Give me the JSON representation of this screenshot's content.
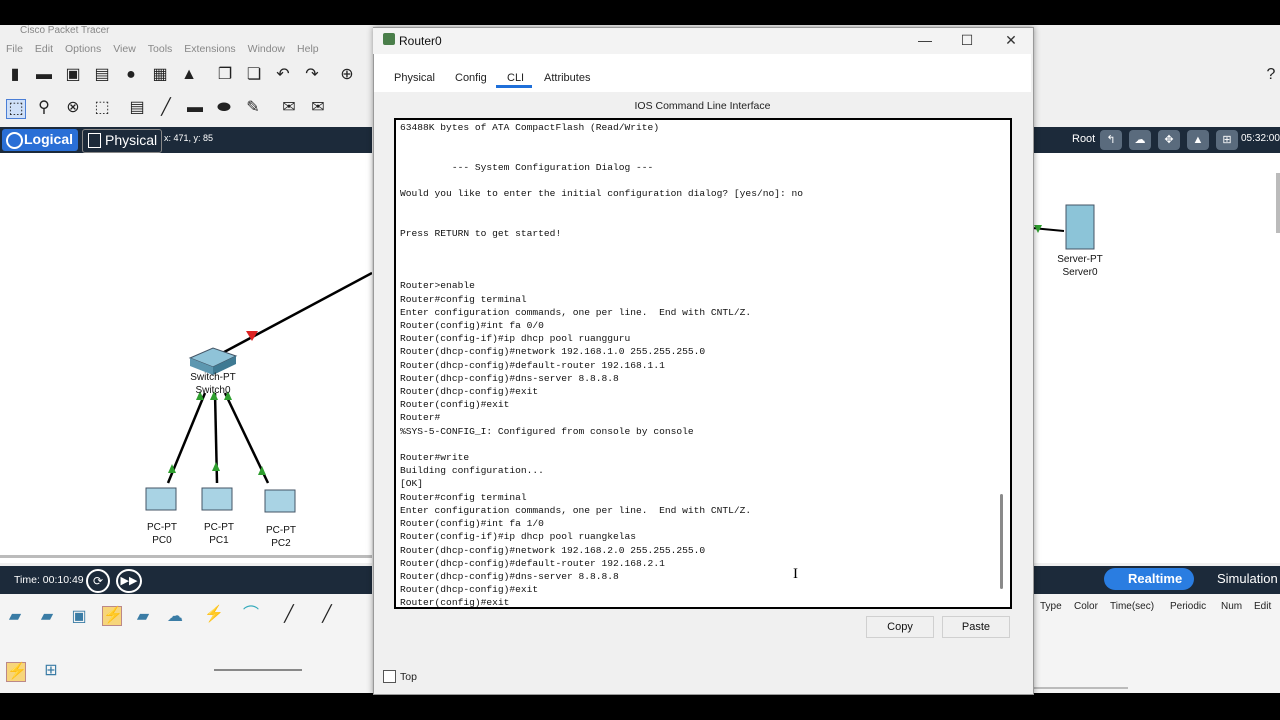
{
  "app": {
    "title": "Cisco Packet Tracer",
    "menu": [
      "File",
      "Edit",
      "Options",
      "View",
      "Tools",
      "Extensions",
      "Window",
      "Help"
    ],
    "view_tabs": {
      "logical": "Logical",
      "physical": "Physical"
    },
    "coords": "x: 471, y: 85",
    "root_label": "Root",
    "clock": "05:32:00",
    "time_label": "Time: 00:10:49",
    "realtime_label": "Realtime",
    "simulation_label": "Simulation",
    "event_columns": [
      "Type",
      "Color",
      "Time(sec)",
      "Periodic",
      "Num",
      "Edit"
    ]
  },
  "devices": {
    "switch": {
      "line1": "Switch-PT",
      "line2": "Switch0"
    },
    "pc0": {
      "line1": "PC-PT",
      "line2": "PC0"
    },
    "pc1": {
      "line1": "PC-PT",
      "line2": "PC1"
    },
    "pc2": {
      "line1": "PC-PT",
      "line2": "PC2"
    },
    "server": {
      "line1": "Server-PT",
      "line2": "Server0"
    }
  },
  "router_window": {
    "title": "Router0",
    "controls": {
      "minimize": "—",
      "maximize": "☐",
      "close": "✕"
    },
    "tabs": [
      "Physical",
      "Config",
      "CLI",
      "Attributes"
    ],
    "active_tab": "CLI",
    "cli_header": "IOS Command Line Interface",
    "copy_label": "Copy",
    "paste_label": "Paste",
    "top_label": "Top",
    "console_lines": [
      "63488K bytes of ATA CompactFlash (Read/Write)",
      "",
      "",
      "         --- System Configuration Dialog ---",
      "",
      "Would you like to enter the initial configuration dialog? [yes/no]: no",
      "",
      "",
      "Press RETURN to get started!",
      "",
      "",
      "",
      "Router>enable",
      "Router#config terminal",
      "Enter configuration commands, one per line.  End with CNTL/Z.",
      "Router(config)#int fa 0/0",
      "Router(config-if)#ip dhcp pool ruangguru",
      "Router(dhcp-config)#network 192.168.1.0 255.255.255.0",
      "Router(dhcp-config)#default-router 192.168.1.1",
      "Router(dhcp-config)#dns-server 8.8.8.8",
      "Router(dhcp-config)#exit",
      "Router(config)#exit",
      "Router#",
      "%SYS-5-CONFIG_I: Configured from console by console",
      "",
      "Router#write",
      "Building configuration...",
      "[OK]",
      "Router#config terminal",
      "Enter configuration commands, one per line.  End with CNTL/Z.",
      "Router(config)#int fa 1/0",
      "Router(config-if)#ip dhcp pool ruangkelas",
      "Router(dhcp-config)#network 192.168.2.0 255.255.255.0",
      "Router(dhcp-config)#default-router 192.168.2.1",
      "Router(dhcp-config)#dns-server 8.8.8.8",
      "Router(dhcp-config)#exit",
      "Router(config)#exit"
    ]
  },
  "colors": {
    "accent": "#1e6fd9",
    "dark_bar": "#1c2a3a",
    "link_green": "#2e9e2e",
    "link_red": "#d22"
  }
}
